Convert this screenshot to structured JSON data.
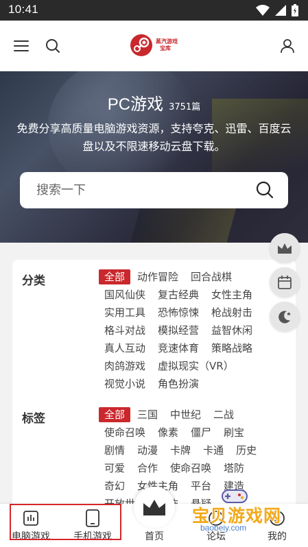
{
  "status_bar": {
    "time": "10:41"
  },
  "header": {
    "logo_line1": "蒸汽游戏",
    "logo_line2": "宝库"
  },
  "hero": {
    "title": "PC游戏",
    "count": "3751篇",
    "description": "免费分享高质量电脑游戏资源，支持夸克、迅雷、百度云盘以及不限速移动云盘下载。",
    "search_placeholder": "搜索一下"
  },
  "filters": {
    "category": {
      "label": "分类",
      "tags": [
        "全部",
        "动作冒险",
        "回合战棋",
        "国风仙侠",
        "复古经典",
        "女性主角",
        "实用工具",
        "恐怖惊悚",
        "枪战射击",
        "格斗对战",
        "模拟经营",
        "益智休闲",
        "真人互动",
        "竞速体育",
        "策略战略",
        "肉鸽游戏",
        "虚拟现实（VR）",
        "视觉小说",
        "角色扮演"
      ]
    },
    "tags": {
      "label": "标签",
      "tags": [
        "全部",
        "三国",
        "中世纪",
        "二战",
        "使命召唤",
        "像素",
        "僵尸",
        "刷宝",
        "剧情",
        "动漫",
        "卡牌",
        "卡通",
        "历史",
        "可爱",
        "合作",
        "使命召唤",
        "塔防",
        "奇幻",
        "女性主角",
        "平台",
        "建造",
        "开放世界",
        "恐怖",
        "悬疑"
      ]
    }
  },
  "bottom_nav": {
    "items": [
      {
        "label": "电脑游戏",
        "icon": "bar-chart-icon"
      },
      {
        "label": "手机游戏",
        "icon": "phone-icon"
      },
      {
        "label": "首页",
        "icon": "crown-icon"
      },
      {
        "label": "论坛",
        "icon": "forum-icon"
      },
      {
        "label": "我的",
        "icon": "smile-icon"
      }
    ]
  },
  "watermark": {
    "text": "宝贝游戏网",
    "url": "baobeiy.com"
  },
  "colors": {
    "accent": "#c9282d",
    "highlight_border": "#d6262b"
  }
}
